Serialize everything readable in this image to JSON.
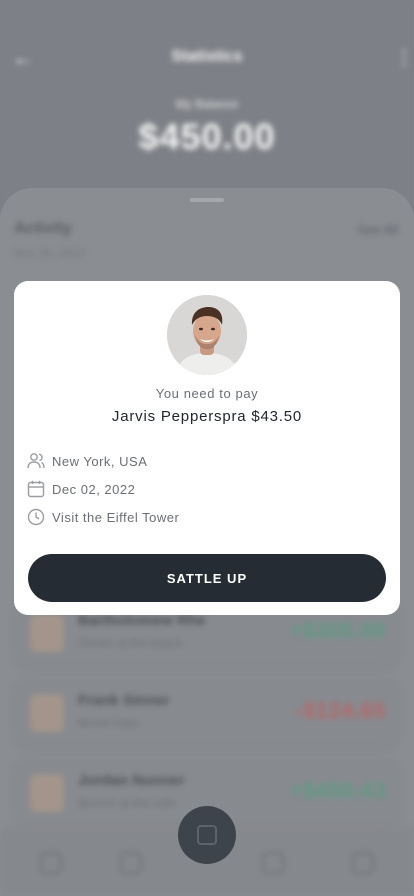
{
  "header": {
    "title": "Statistics",
    "balance_label": "My Balance",
    "balance_value": "$450.00"
  },
  "activity": {
    "title": "Activity",
    "see_all": "See All",
    "date": "Nov 30, 2022",
    "items": [
      {
        "name": "Bartholomew Rhe",
        "desc": "Dinner at the beach",
        "amount": "+$305.00",
        "color": "#5f9b82"
      },
      {
        "name": "Frank Sinner",
        "desc": "Movie Date",
        "amount": "-$124.65",
        "color": "#b56868"
      },
      {
        "name": "Jordan Nunner",
        "desc": "Brunch at the cafe",
        "amount": "+$450.43",
        "color": "#5f9b82"
      }
    ]
  },
  "modal": {
    "pay_label": "You need to pay",
    "pay_name": "Jarvis Pepperspra $43.50",
    "details": [
      {
        "icon": "users-icon",
        "text": "New York, USA"
      },
      {
        "icon": "calendar-icon",
        "text": "Dec 02, 2022"
      },
      {
        "icon": "clock-icon",
        "text": "Visit the Eiffel Tower"
      }
    ],
    "button_label": "SATTLE UP"
  },
  "colors": {
    "overlay": "#7d8086",
    "button": "#262c34",
    "positive": "#5f9b82",
    "negative": "#b56868"
  }
}
